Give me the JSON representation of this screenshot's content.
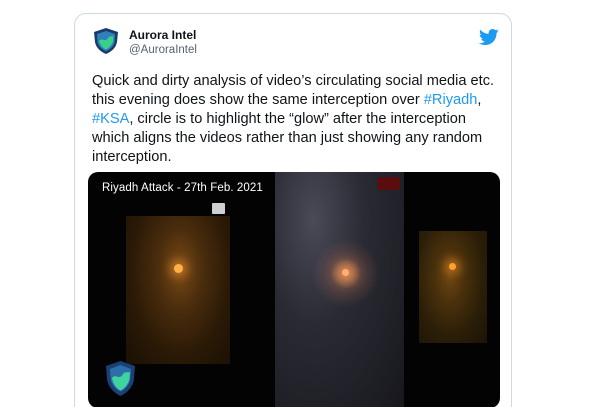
{
  "author": {
    "name": "Aurora Intel",
    "handle": "@AuroraIntel"
  },
  "tweet": {
    "text_part1": "Quick and dirty analysis of video’s circulating social media etc. this evening does show the same interception over ",
    "hashtag1": "#Riyadh",
    "separator": ", ",
    "hashtag2": "#KSA",
    "text_part2": ", circle is to highlight the “glow” after the interception which aligns the videos rather than just showing any random interception."
  },
  "media": {
    "title": "Riyadh Attack - 27th Feb. 2021"
  },
  "colors": {
    "accent": "#1d9bf0",
    "text": "#0f1419",
    "muted": "#536471",
    "border": "#cfd9de"
  },
  "icons": {
    "avatar": "aurora-shield-icon",
    "brand": "twitter-bird-icon"
  }
}
